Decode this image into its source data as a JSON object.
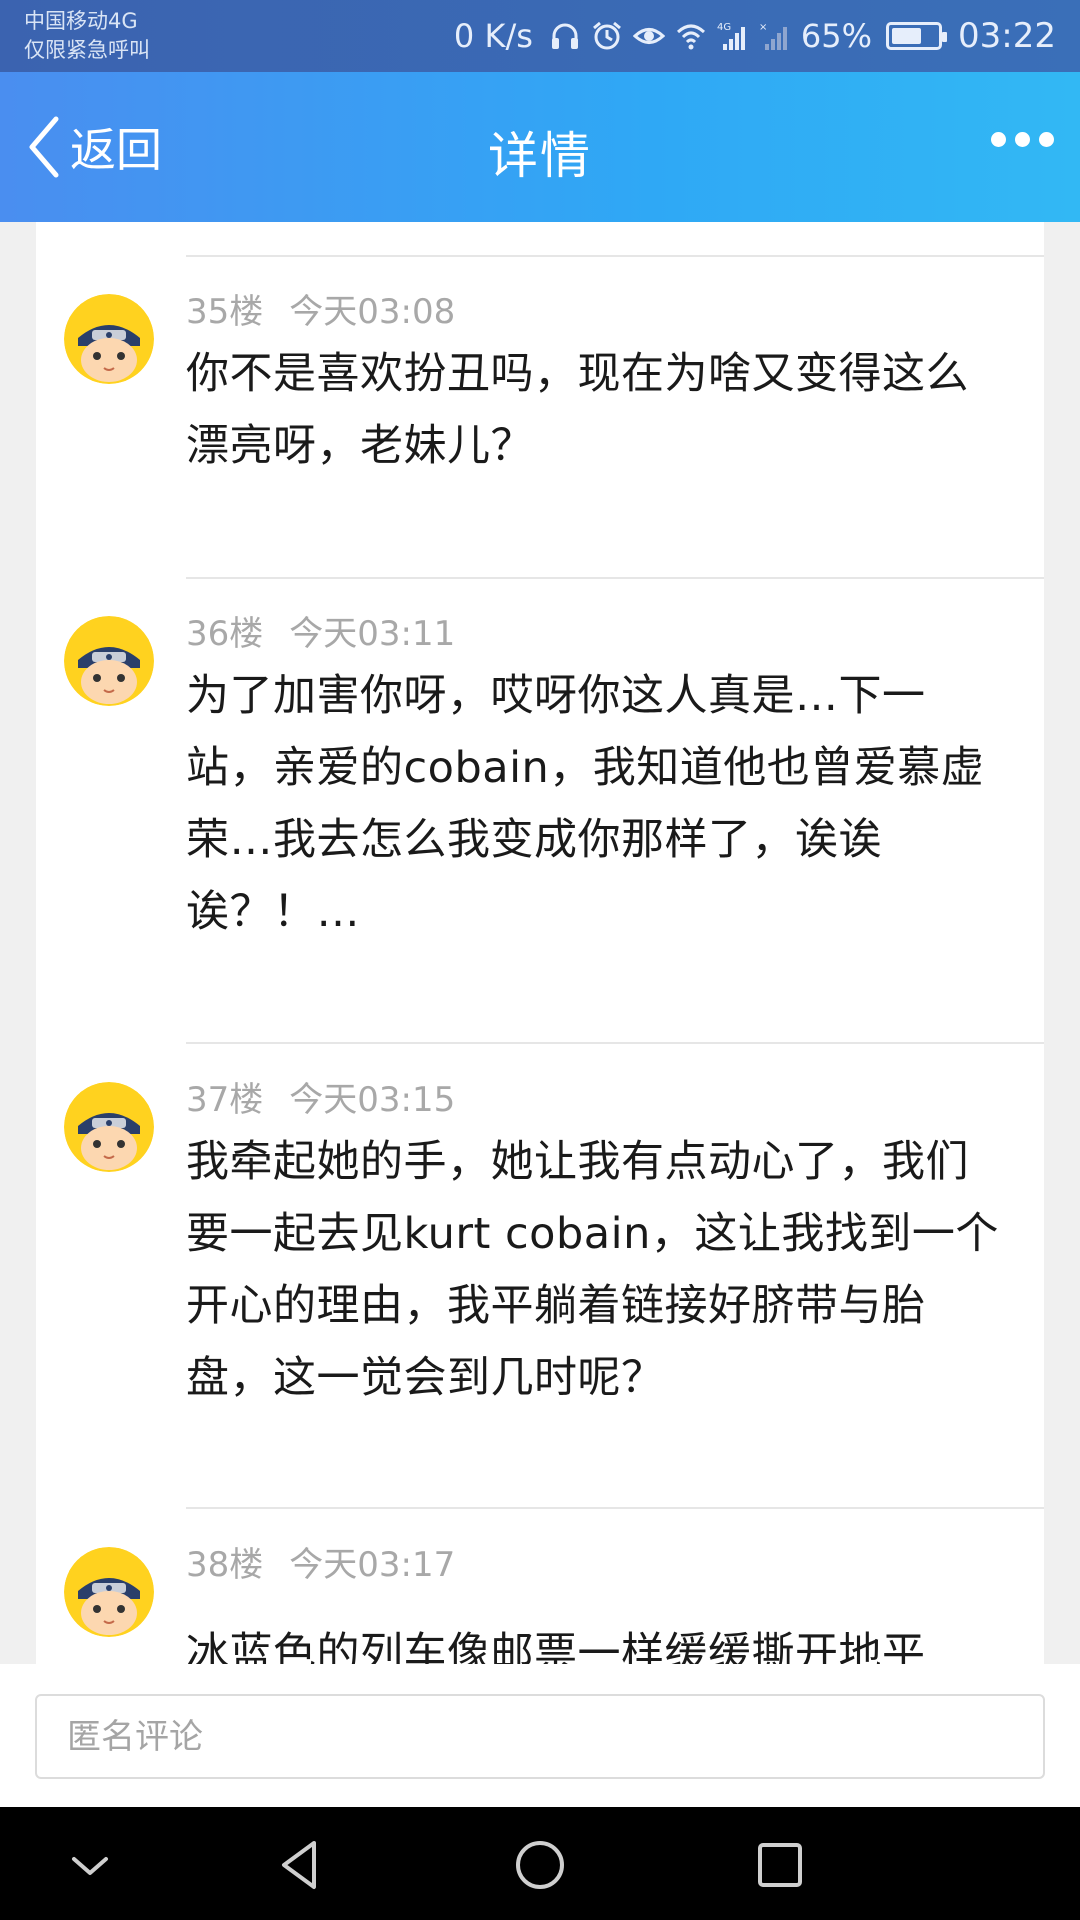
{
  "status_bar": {
    "carrier_line1": "中国移动4G",
    "carrier_line2": "仅限紧急呼叫",
    "net_speed": "0 K/s",
    "battery_percent": "65%",
    "battery_level": 0.65,
    "time": "03:22"
  },
  "header": {
    "back_label": "返回",
    "title": "详情"
  },
  "comments": [
    {
      "floor": "35楼",
      "time": "今天03:08",
      "text": "你不是喜欢扮丑吗，现在为啥又变得这么漂亮呀，老妹儿？"
    },
    {
      "floor": "36楼",
      "time": "今天03:11",
      "text": "为了加害你呀，哎呀你这人真是…下一站，亲爱的cobain，我知道他也曾爱慕虚荣…我去怎么我变成你那样了，诶诶诶？！…"
    },
    {
      "floor": "37楼",
      "time": "今天03:15",
      "text": "我牵起她的手，她让我有点动心了，我们要一起去见kurt cobain，这让我找到一个开心的理由，我平躺着链接好脐带与胎盘，这一觉会到几时呢？"
    },
    {
      "floor": "38楼",
      "time": "今天03:17",
      "text": "冰蓝色的列车像邮票一样缓缓撕开地平"
    }
  ],
  "input": {
    "placeholder": "匿名评论"
  }
}
